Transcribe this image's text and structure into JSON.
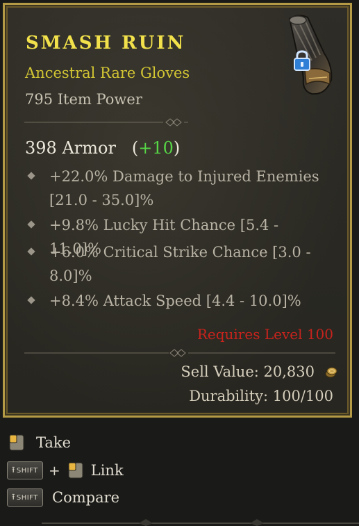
{
  "item": {
    "name": "Smash Ruin",
    "type": "Ancestral Rare Gloves",
    "item_power": "795 Item Power",
    "armor_value": "398 Armor",
    "armor_bonus": "+10",
    "affixes": [
      {
        "text": "+22.0% Damage to Injured Enemies [21.0 - 35.0]%"
      },
      {
        "text": "+9.8% Lucky Hit Chance [5.4 - 11.0]%"
      },
      {
        "text": "+6.0% Critical Strike Chance [3.0 - 8.0]%"
      },
      {
        "text": "+8.4% Attack Speed [4.4 - 10.0]%"
      }
    ],
    "requirement": "Requires Level 100",
    "sell_value": "Sell Value: 20,830",
    "durability": "Durability: 100/100",
    "locked": true
  },
  "actions": {
    "take_label": "Take",
    "link_label": "Link",
    "compare_label": "Compare",
    "shift_key": "SHIFT",
    "plus": "+"
  },
  "colors": {
    "item_name": "#f2e14b",
    "rarity": "#d2c533",
    "bonus": "#56d646",
    "requirement": "#c8231d",
    "frame": "#b49a45"
  },
  "icons": {
    "item": "gloves-icon",
    "lock": "lock-icon",
    "gold": "gold-coin-icon",
    "mouse": "mouse-left-click-icon",
    "shift": "shift-key-icon"
  }
}
